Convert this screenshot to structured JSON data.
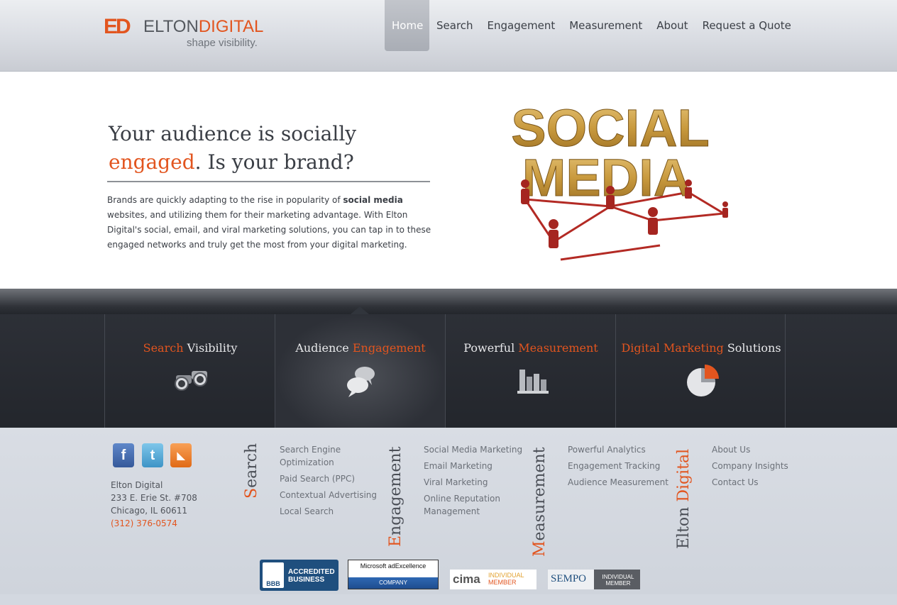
{
  "logo": {
    "mark": "ED",
    "name_part1": "ELTON",
    "name_part2": "DIGITAL",
    "tagline": "shape visibility."
  },
  "nav": {
    "items": [
      "Home",
      "Search",
      "Engagement",
      "Measurement",
      "About",
      "Request a Quote"
    ],
    "active": "Home"
  },
  "hero": {
    "headline_line1": "Your audience is socially",
    "headline_accent": "engaged",
    "headline_rest": ". Is your brand?",
    "body_part1": "Brands are quickly adapting to the rise in popularity of ",
    "body_bold": "social media",
    "body_part2": " websites, and utilizing them for their marketing advantage. With Elton Digital's social, email, and viral marketing solutions, you can tap in to these engaged networks and truly get the most from your digital marketing.",
    "art_word1": "SOCIAL",
    "art_word2": "MEDIA"
  },
  "services": [
    {
      "a": "Search",
      "b": " Visibility",
      "icon": "binoculars-icon"
    },
    {
      "a": "Audience ",
      "b": "Engagement",
      "icon": "speech-bubbles-icon"
    },
    {
      "a": "Powerful ",
      "b": "Measurement",
      "icon": "bar-chart-icon"
    },
    {
      "a": "Digital Marketing",
      "b": " Solutions",
      "icon": "pie-chart-icon"
    }
  ],
  "footer": {
    "social": [
      {
        "icon": "facebook-icon",
        "glyph": "f"
      },
      {
        "icon": "twitter-icon",
        "glyph": "t"
      },
      {
        "icon": "rss-icon",
        "glyph": "◣"
      }
    ],
    "address": {
      "company": "Elton Digital",
      "street": "233 E. Erie St. #708",
      "city": "Chicago, IL 60611",
      "phone": "(312) 376-0574"
    },
    "columns": [
      {
        "heading": "Search",
        "links": [
          "Search Engine Optimization",
          "Paid Search (PPC)",
          "Contextual Advertising",
          "Local Search"
        ]
      },
      {
        "heading": "Engagement",
        "links": [
          "Social Media Marketing",
          "Email Marketing",
          "Viral Marketing",
          "Online Reputation Management"
        ]
      },
      {
        "heading": "Measurement",
        "links": [
          "Powerful Analytics",
          "Engagement Tracking",
          "Audience Measurement"
        ]
      },
      {
        "heading_part1": "Elton ",
        "heading_part2": "Digital",
        "links": [
          "About Us",
          "Company Insights",
          "Contact Us"
        ]
      }
    ],
    "badges": {
      "bbb_top": "ACCREDITED",
      "bbb_bottom": "BUSINESS",
      "bbb_logo": "BBB",
      "ms_top": "Microsoft adExcellence",
      "ms_bottom": "COMPANY",
      "cima": "cima",
      "cima_top": "INDIVIDUAL",
      "cima_bottom": "MEMBER",
      "sempo": "SEMPO",
      "sempo_top": "INDIVIDUAL",
      "sempo_bottom": "MEMBER"
    }
  },
  "colors": {
    "accent": "#e2551f",
    "dark_band": "#2d3037",
    "footer_bg": "#d3d8e0"
  }
}
